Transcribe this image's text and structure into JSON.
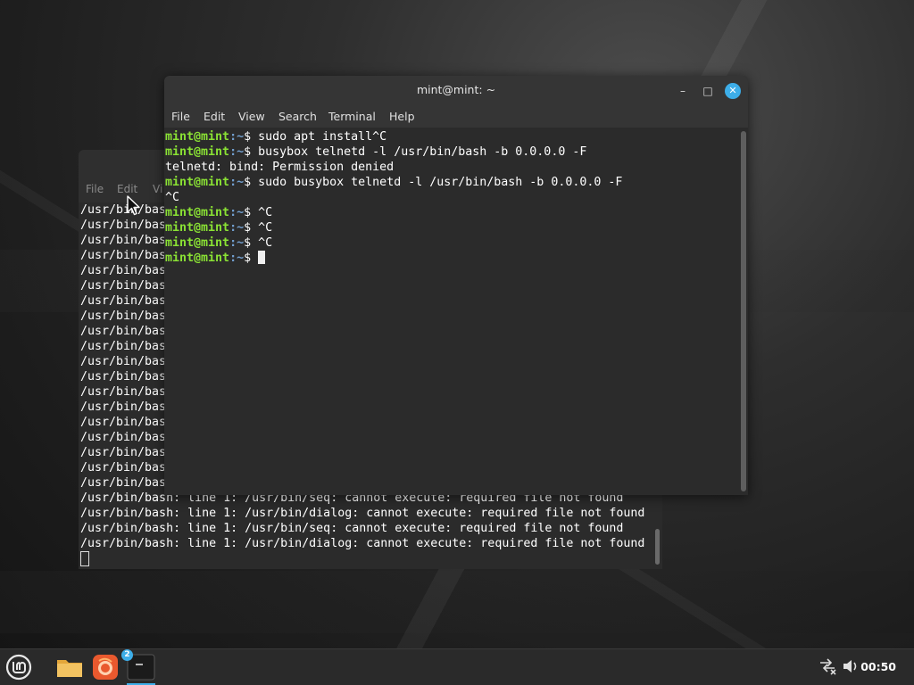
{
  "front_terminal": {
    "title": "mint@mint: ~",
    "menu": [
      "File",
      "Edit",
      "View",
      "Search",
      "Terminal",
      "Help"
    ],
    "lines": [
      {
        "prompt_user": "mint@mint",
        "prompt_path": ":~",
        "prompt_sign": "$ ",
        "text": "sudo apt install^C"
      },
      {
        "prompt_user": "mint@mint",
        "prompt_path": ":~",
        "prompt_sign": "$ ",
        "text": "busybox telnetd -l /usr/bin/bash -b 0.0.0.0 -F"
      },
      {
        "prompt_user": "",
        "prompt_path": "",
        "prompt_sign": "",
        "text": "telnetd: bind: Permission denied"
      },
      {
        "prompt_user": "mint@mint",
        "prompt_path": ":~",
        "prompt_sign": "$ ",
        "text": "sudo busybox telnetd -l /usr/bin/bash -b 0.0.0.0 -F"
      },
      {
        "prompt_user": "",
        "prompt_path": "",
        "prompt_sign": "",
        "text": "^C"
      },
      {
        "prompt_user": "mint@mint",
        "prompt_path": ":~",
        "prompt_sign": "$ ",
        "text": "^C"
      },
      {
        "prompt_user": "mint@mint",
        "prompt_path": ":~",
        "prompt_sign": "$ ",
        "text": "^C"
      },
      {
        "prompt_user": "mint@mint",
        "prompt_path": ":~",
        "prompt_sign": "$ ",
        "text": "^C"
      },
      {
        "prompt_user": "mint@mint",
        "prompt_path": ":~",
        "prompt_sign": "$ ",
        "text": ""
      }
    ]
  },
  "back_terminal": {
    "menu": [
      "File",
      "Edit",
      "Vi"
    ],
    "hidden_prefix": "/usr/bin/bas",
    "hidden_prefix_count": 19,
    "lines": [
      "/usr/bin/bash: line 1: /usr/bin/seq: cannot execute: required file not found",
      "/usr/bin/bash: line 1: /usr/bin/dialog: cannot execute: required file not found",
      "/usr/bin/bash: line 1: /usr/bin/seq: cannot execute: required file not found",
      "/usr/bin/bash: line 1: /usr/bin/dialog: cannot execute: required file not found"
    ]
  },
  "taskbar": {
    "clock": "00:50",
    "terminal_badge": "2",
    "apps": [
      "menu-icon",
      "files-icon",
      "firefox-icon",
      "terminal-icon"
    ],
    "tray": [
      "network-disconnected-icon",
      "volume-icon"
    ]
  },
  "colors": {
    "prompt_user": "#8ae234",
    "prompt_path": "#729fcf",
    "accent": "#3daee9"
  }
}
